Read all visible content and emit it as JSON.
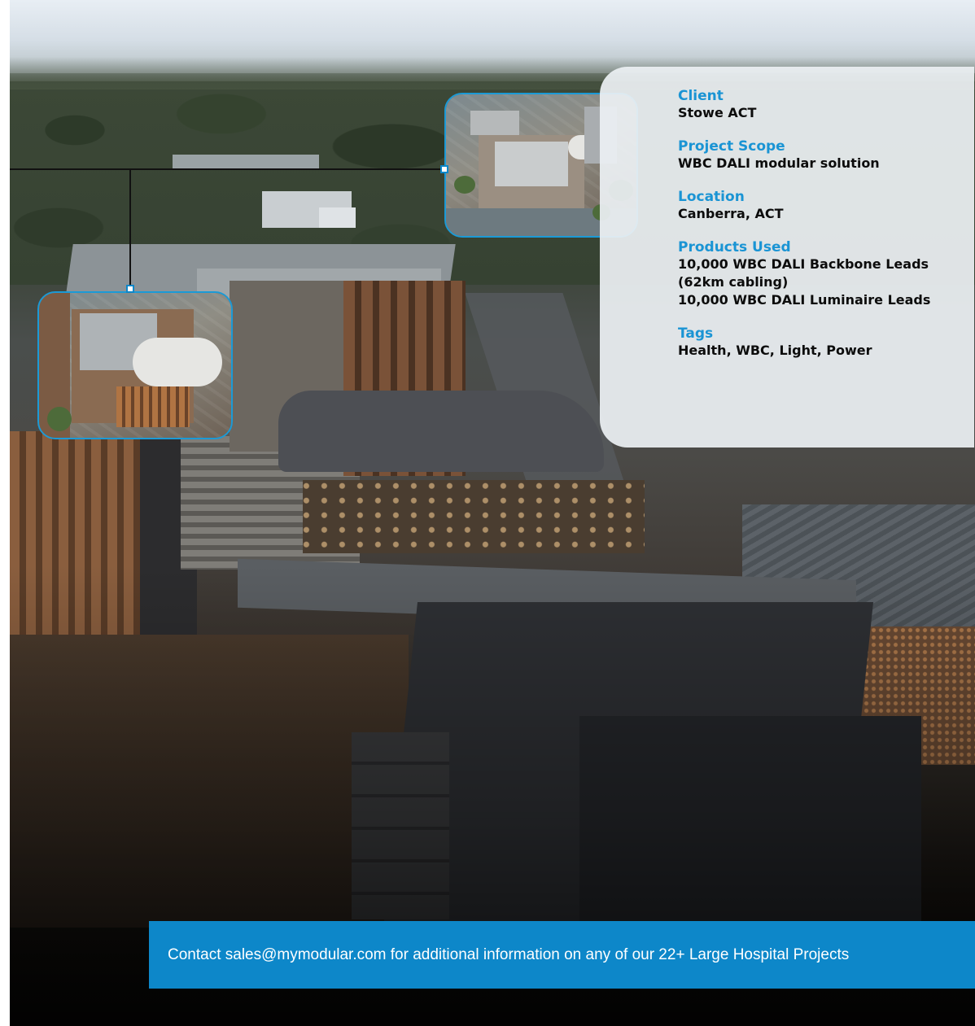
{
  "project_card": {
    "fields": [
      {
        "label": "Client",
        "value": "Stowe ACT"
      },
      {
        "label": "Project Scope",
        "value": "WBC DALI modular solution"
      },
      {
        "label": "Location",
        "value": "Canberra, ACT"
      },
      {
        "label": "Products Used",
        "value_lines": [
          "10,000 WBC DALI Backbone Leads",
          "(62km cabling)",
          "10,000 WBC DALI Luminaire Leads"
        ]
      },
      {
        "label": "Tags",
        "value": "Health, WBC, Light, Power"
      }
    ]
  },
  "contact_banner": {
    "text": "Contact sales@mymodular.com for additional information on any of our 22+ Large Hospital Projects"
  },
  "colors": {
    "accent": "#1a94d4",
    "banner": "#0d87c9",
    "inset_border": "#1b9ad6"
  }
}
